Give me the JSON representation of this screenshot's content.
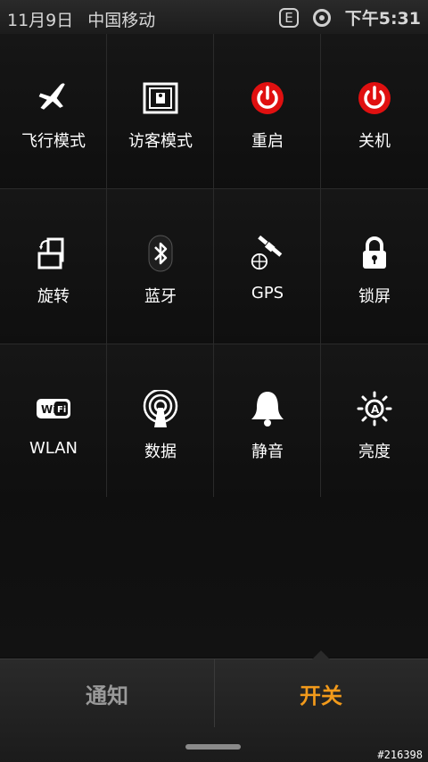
{
  "status_bar": {
    "date": "11月9日",
    "carrier": "中国移动",
    "network": "E",
    "time": "下午5:31"
  },
  "toggles": [
    {
      "label": "飞行模式",
      "icon": "airplane-icon"
    },
    {
      "label": "访客模式",
      "icon": "guest-mode-icon"
    },
    {
      "label": "重启",
      "icon": "power-icon",
      "color": "#e01010"
    },
    {
      "label": "关机",
      "icon": "power-icon",
      "color": "#e01010"
    },
    {
      "label": "旋转",
      "icon": "rotate-icon"
    },
    {
      "label": "蓝牙",
      "icon": "bluetooth-icon"
    },
    {
      "label": "GPS",
      "icon": "gps-satellite-icon"
    },
    {
      "label": "锁屏",
      "icon": "lock-icon"
    },
    {
      "label": "WLAN",
      "icon": "wifi-icon"
    },
    {
      "label": "数据",
      "icon": "antenna-icon"
    },
    {
      "label": "静音",
      "icon": "bell-icon"
    },
    {
      "label": "亮度",
      "icon": "brightness-auto-icon"
    }
  ],
  "tabs": {
    "notify": "通知",
    "switch": "开关"
  },
  "watermark": "#216398",
  "colors": {
    "accent": "#f29a1b",
    "power_red": "#e01010"
  }
}
